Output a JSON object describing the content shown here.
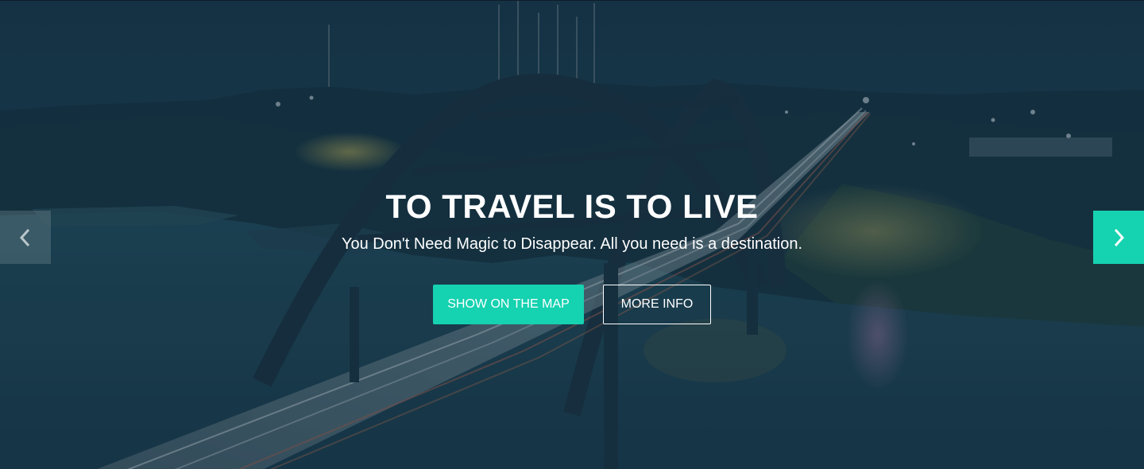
{
  "hero": {
    "title": "TO TRAVEL IS TO LIVE",
    "subtitle": "You Don't Need Magic to Disappear. All you need is a destination.",
    "background": "night-bridge-city-photo"
  },
  "actions": {
    "primary_label": "SHOW ON THE MAP",
    "secondary_label": "MORE INFO"
  },
  "carousel": {
    "prev_icon": "chevron-left-icon",
    "next_icon": "chevron-right-icon"
  },
  "colors": {
    "accent": "#15d2b0",
    "text": "#ffffff",
    "overlay": "#1c3346"
  }
}
